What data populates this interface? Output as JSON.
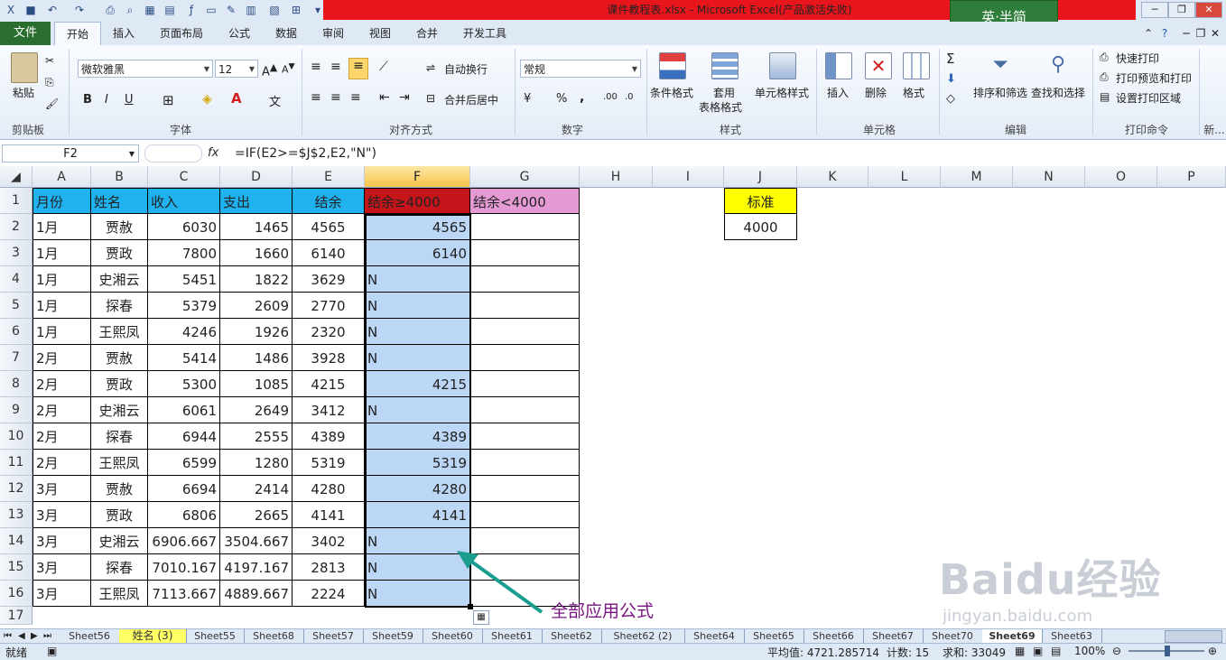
{
  "title": "课件教程表.xlsx - Microsoft Excel(产品激活失败)",
  "logo_text": "英·半简",
  "file_tab": "文件",
  "tabs": [
    "开始",
    "插入",
    "页面布局",
    "公式",
    "数据",
    "审阅",
    "视图",
    "合并",
    "开发工具"
  ],
  "ribbon": {
    "clipboard": {
      "paste": "粘贴",
      "label": "剪贴板"
    },
    "font": {
      "name": "微软雅黑",
      "size": "12",
      "label": "字体",
      "bold": "B",
      "italic": "I",
      "underline": "U"
    },
    "align": {
      "wrap": "自动换行",
      "merge": "合并后居中",
      "label": "对齐方式"
    },
    "number": {
      "format": "常规",
      "percent": "%",
      "comma": ",",
      "label": "数字"
    },
    "styles": {
      "cond": "条件格式",
      "table": "套用",
      "table2": "表格格式",
      "cell": "单元格样式",
      "label": "样式"
    },
    "cells": {
      "insert": "插入",
      "delete": "删除",
      "format": "格式",
      "label": "单元格"
    },
    "edit": {
      "sort": "排序和筛选",
      "find": "查找和选择",
      "label": "编辑"
    },
    "print": {
      "quick": "快速打印",
      "preview": "打印预览和打印",
      "area": "设置打印区域",
      "label": "打印命令",
      "more": "新..."
    }
  },
  "name_box": "F2",
  "fx": "fx",
  "formula": "=IF(E2>=$J$2,E2,\"N\")",
  "columns": [
    "A",
    "B",
    "C",
    "D",
    "E",
    "F",
    "G",
    "H",
    "I",
    "J",
    "K",
    "L",
    "M",
    "N",
    "O",
    "P"
  ],
  "headers": [
    "月份",
    "姓名",
    "收入",
    "支出",
    "结余",
    "结余≥4000",
    "结余<4000"
  ],
  "rows": [
    [
      "1月",
      "贾赦",
      "6030",
      "1465",
      "4565",
      "4565"
    ],
    [
      "1月",
      "贾政",
      "7800",
      "1660",
      "6140",
      "6140"
    ],
    [
      "1月",
      "史湘云",
      "5451",
      "1822",
      "3629",
      "N"
    ],
    [
      "1月",
      "探春",
      "5379",
      "2609",
      "2770",
      "N"
    ],
    [
      "1月",
      "王熙凤",
      "4246",
      "1926",
      "2320",
      "N"
    ],
    [
      "2月",
      "贾赦",
      "5414",
      "1486",
      "3928",
      "N"
    ],
    [
      "2月",
      "贾政",
      "5300",
      "1085",
      "4215",
      "4215"
    ],
    [
      "2月",
      "史湘云",
      "6061",
      "2649",
      "3412",
      "N"
    ],
    [
      "2月",
      "探春",
      "6944",
      "2555",
      "4389",
      "4389"
    ],
    [
      "2月",
      "王熙凤",
      "6599",
      "1280",
      "5319",
      "5319"
    ],
    [
      "3月",
      "贾赦",
      "6694",
      "2414",
      "4280",
      "4280"
    ],
    [
      "3月",
      "贾政",
      "6806",
      "2665",
      "4141",
      "4141"
    ],
    [
      "3月",
      "史湘云",
      "6906.667",
      "3504.667",
      "3402",
      "N"
    ],
    [
      "3月",
      "探春",
      "7010.167",
      "4197.167",
      "2813",
      "N"
    ],
    [
      "3月",
      "王熙凤",
      "7113.667",
      "4889.667",
      "2224",
      "N"
    ]
  ],
  "standard": {
    "label": "标准",
    "value": "4000"
  },
  "annotation": "全部应用公式",
  "sheets": [
    "Sheet56",
    "姓名 (3)",
    "Sheet55",
    "Sheet68",
    "Sheet57",
    "Sheet59",
    "Sheet60",
    "Sheet61",
    "Sheet62",
    "Sheet62 (2)",
    "Sheet64",
    "Sheet65",
    "Sheet66",
    "Sheet67",
    "Sheet70",
    "Sheet69",
    "Sheet63"
  ],
  "status": {
    "ready": "就绪",
    "avg": "平均值: 4721.285714",
    "count": "计数: 15",
    "sum": "求和: 33049",
    "zoom": "100%"
  },
  "watermark": "Baidu经验",
  "watermark_url": "jingyan.baidu.com",
  "colors": {
    "header_blue": "#1fb2ee",
    "header_red": "#c5151a",
    "header_pink": "#e59ad6",
    "selection": "#bcd6f5",
    "standard_yellow": "#ffff00",
    "annotation": "#7a1680",
    "arrow": "#1a9d8f"
  }
}
